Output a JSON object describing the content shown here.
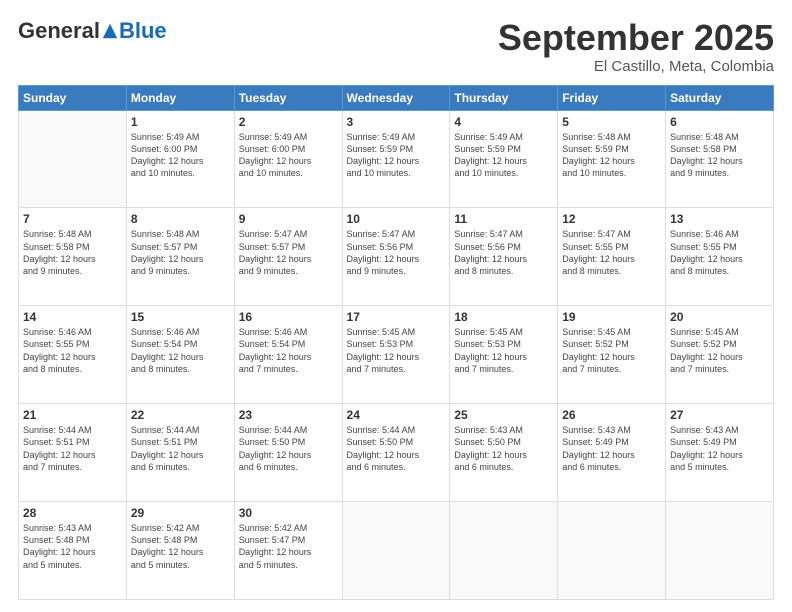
{
  "header": {
    "logo_general": "General",
    "logo_blue": "Blue",
    "month_title": "September 2025",
    "location": "El Castillo, Meta, Colombia"
  },
  "days_of_week": [
    "Sunday",
    "Monday",
    "Tuesday",
    "Wednesday",
    "Thursday",
    "Friday",
    "Saturday"
  ],
  "weeks": [
    [
      {
        "day": "",
        "info": ""
      },
      {
        "day": "1",
        "info": "Sunrise: 5:49 AM\nSunset: 6:00 PM\nDaylight: 12 hours\nand 10 minutes."
      },
      {
        "day": "2",
        "info": "Sunrise: 5:49 AM\nSunset: 6:00 PM\nDaylight: 12 hours\nand 10 minutes."
      },
      {
        "day": "3",
        "info": "Sunrise: 5:49 AM\nSunset: 5:59 PM\nDaylight: 12 hours\nand 10 minutes."
      },
      {
        "day": "4",
        "info": "Sunrise: 5:49 AM\nSunset: 5:59 PM\nDaylight: 12 hours\nand 10 minutes."
      },
      {
        "day": "5",
        "info": "Sunrise: 5:48 AM\nSunset: 5:59 PM\nDaylight: 12 hours\nand 10 minutes."
      },
      {
        "day": "6",
        "info": "Sunrise: 5:48 AM\nSunset: 5:58 PM\nDaylight: 12 hours\nand 9 minutes."
      }
    ],
    [
      {
        "day": "7",
        "info": "Sunrise: 5:48 AM\nSunset: 5:58 PM\nDaylight: 12 hours\nand 9 minutes."
      },
      {
        "day": "8",
        "info": "Sunrise: 5:48 AM\nSunset: 5:57 PM\nDaylight: 12 hours\nand 9 minutes."
      },
      {
        "day": "9",
        "info": "Sunrise: 5:47 AM\nSunset: 5:57 PM\nDaylight: 12 hours\nand 9 minutes."
      },
      {
        "day": "10",
        "info": "Sunrise: 5:47 AM\nSunset: 5:56 PM\nDaylight: 12 hours\nand 9 minutes."
      },
      {
        "day": "11",
        "info": "Sunrise: 5:47 AM\nSunset: 5:56 PM\nDaylight: 12 hours\nand 8 minutes."
      },
      {
        "day": "12",
        "info": "Sunrise: 5:47 AM\nSunset: 5:55 PM\nDaylight: 12 hours\nand 8 minutes."
      },
      {
        "day": "13",
        "info": "Sunrise: 5:46 AM\nSunset: 5:55 PM\nDaylight: 12 hours\nand 8 minutes."
      }
    ],
    [
      {
        "day": "14",
        "info": "Sunrise: 5:46 AM\nSunset: 5:55 PM\nDaylight: 12 hours\nand 8 minutes."
      },
      {
        "day": "15",
        "info": "Sunrise: 5:46 AM\nSunset: 5:54 PM\nDaylight: 12 hours\nand 8 minutes."
      },
      {
        "day": "16",
        "info": "Sunrise: 5:46 AM\nSunset: 5:54 PM\nDaylight: 12 hours\nand 7 minutes."
      },
      {
        "day": "17",
        "info": "Sunrise: 5:45 AM\nSunset: 5:53 PM\nDaylight: 12 hours\nand 7 minutes."
      },
      {
        "day": "18",
        "info": "Sunrise: 5:45 AM\nSunset: 5:53 PM\nDaylight: 12 hours\nand 7 minutes."
      },
      {
        "day": "19",
        "info": "Sunrise: 5:45 AM\nSunset: 5:52 PM\nDaylight: 12 hours\nand 7 minutes."
      },
      {
        "day": "20",
        "info": "Sunrise: 5:45 AM\nSunset: 5:52 PM\nDaylight: 12 hours\nand 7 minutes."
      }
    ],
    [
      {
        "day": "21",
        "info": "Sunrise: 5:44 AM\nSunset: 5:51 PM\nDaylight: 12 hours\nand 7 minutes."
      },
      {
        "day": "22",
        "info": "Sunrise: 5:44 AM\nSunset: 5:51 PM\nDaylight: 12 hours\nand 6 minutes."
      },
      {
        "day": "23",
        "info": "Sunrise: 5:44 AM\nSunset: 5:50 PM\nDaylight: 12 hours\nand 6 minutes."
      },
      {
        "day": "24",
        "info": "Sunrise: 5:44 AM\nSunset: 5:50 PM\nDaylight: 12 hours\nand 6 minutes."
      },
      {
        "day": "25",
        "info": "Sunrise: 5:43 AM\nSunset: 5:50 PM\nDaylight: 12 hours\nand 6 minutes."
      },
      {
        "day": "26",
        "info": "Sunrise: 5:43 AM\nSunset: 5:49 PM\nDaylight: 12 hours\nand 6 minutes."
      },
      {
        "day": "27",
        "info": "Sunrise: 5:43 AM\nSunset: 5:49 PM\nDaylight: 12 hours\nand 5 minutes."
      }
    ],
    [
      {
        "day": "28",
        "info": "Sunrise: 5:43 AM\nSunset: 5:48 PM\nDaylight: 12 hours\nand 5 minutes."
      },
      {
        "day": "29",
        "info": "Sunrise: 5:42 AM\nSunset: 5:48 PM\nDaylight: 12 hours\nand 5 minutes."
      },
      {
        "day": "30",
        "info": "Sunrise: 5:42 AM\nSunset: 5:47 PM\nDaylight: 12 hours\nand 5 minutes."
      },
      {
        "day": "",
        "info": ""
      },
      {
        "day": "",
        "info": ""
      },
      {
        "day": "",
        "info": ""
      },
      {
        "day": "",
        "info": ""
      }
    ]
  ]
}
